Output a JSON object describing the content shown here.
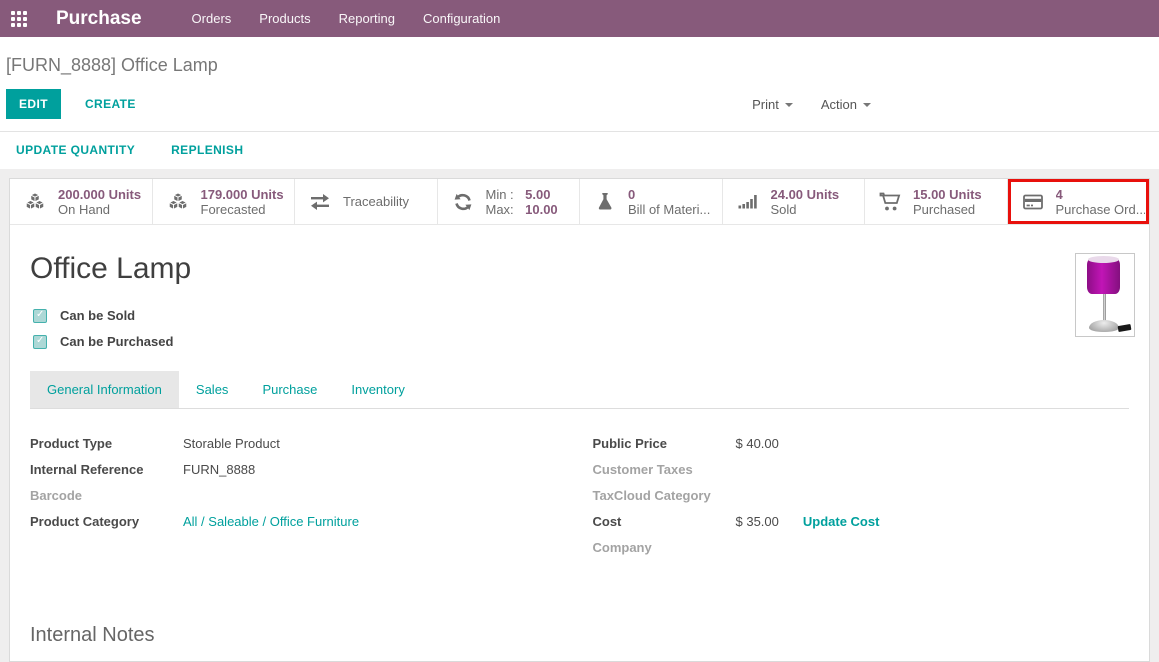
{
  "navbar": {
    "app_title": "Purchase",
    "menus": [
      {
        "label": "Orders"
      },
      {
        "label": "Products"
      },
      {
        "label": "Reporting"
      },
      {
        "label": "Configuration"
      }
    ]
  },
  "breadcrumb": {
    "current": "[FURN_8888] Office Lamp"
  },
  "control_panel": {
    "edit": "EDIT",
    "create": "CREATE",
    "print": "Print",
    "action": "Action"
  },
  "statusbar": {
    "buttons": [
      {
        "label": "UPDATE QUANTITY"
      },
      {
        "label": "REPLENISH"
      }
    ]
  },
  "stat_buttons": [
    {
      "name": "on-hand",
      "icon": "cubes-icon",
      "value": "200.000 Units",
      "label": "On Hand"
    },
    {
      "name": "forecasted",
      "icon": "cubes-icon",
      "value": "179.000 Units",
      "label": "Forecasted"
    },
    {
      "name": "traceability",
      "icon": "exchange-icon",
      "label": "Traceability"
    },
    {
      "name": "reordering-rules",
      "icon": "refresh-icon",
      "min_label": "Min :",
      "min_value": "5.00",
      "max_label": "Max:",
      "max_value": "10.00"
    },
    {
      "name": "bill-of-materials",
      "icon": "flask-icon",
      "value": "0",
      "label": "Bill of Materi..."
    },
    {
      "name": "sold",
      "icon": "bar-chart-icon",
      "value": "24.00 Units",
      "label": "Sold"
    },
    {
      "name": "purchased",
      "icon": "cart-icon",
      "value": "15.00 Units",
      "label": "Purchased"
    },
    {
      "name": "purchase-orders",
      "icon": "credit-card-icon",
      "value": "4",
      "label": "Purchase Ord...",
      "highlighted": true
    }
  ],
  "form": {
    "title": "Office Lamp",
    "checkboxes": [
      {
        "label": "Can be Sold",
        "checked": true
      },
      {
        "label": "Can be Purchased",
        "checked": true
      }
    ],
    "tabs": [
      {
        "label": "General Information",
        "active": true
      },
      {
        "label": "Sales",
        "active": false
      },
      {
        "label": "Purchase",
        "active": false
      },
      {
        "label": "Inventory",
        "active": false
      }
    ],
    "fields_left": [
      {
        "label": "Product Type",
        "value": "Storable Product"
      },
      {
        "label": "Internal Reference",
        "value": "FURN_8888"
      },
      {
        "label": "Barcode",
        "value": ""
      },
      {
        "label": "Product Category",
        "value": "All / Saleable / Office Furniture"
      }
    ],
    "fields_right": [
      {
        "label": "Public Price",
        "value": "$ 40.00"
      },
      {
        "label": "Customer Taxes",
        "value": ""
      },
      {
        "label": "TaxCloud Category",
        "value": ""
      },
      {
        "label": "Cost",
        "value": "$ 35.00",
        "action": "Update Cost"
      },
      {
        "label": "Company",
        "value": ""
      }
    ],
    "notes_title": "Internal Notes"
  },
  "colors": {
    "navbar_bg": "#875A7B",
    "accent": "#00A09D",
    "stat_value": "#875A7B",
    "highlight": "#E8100C"
  }
}
